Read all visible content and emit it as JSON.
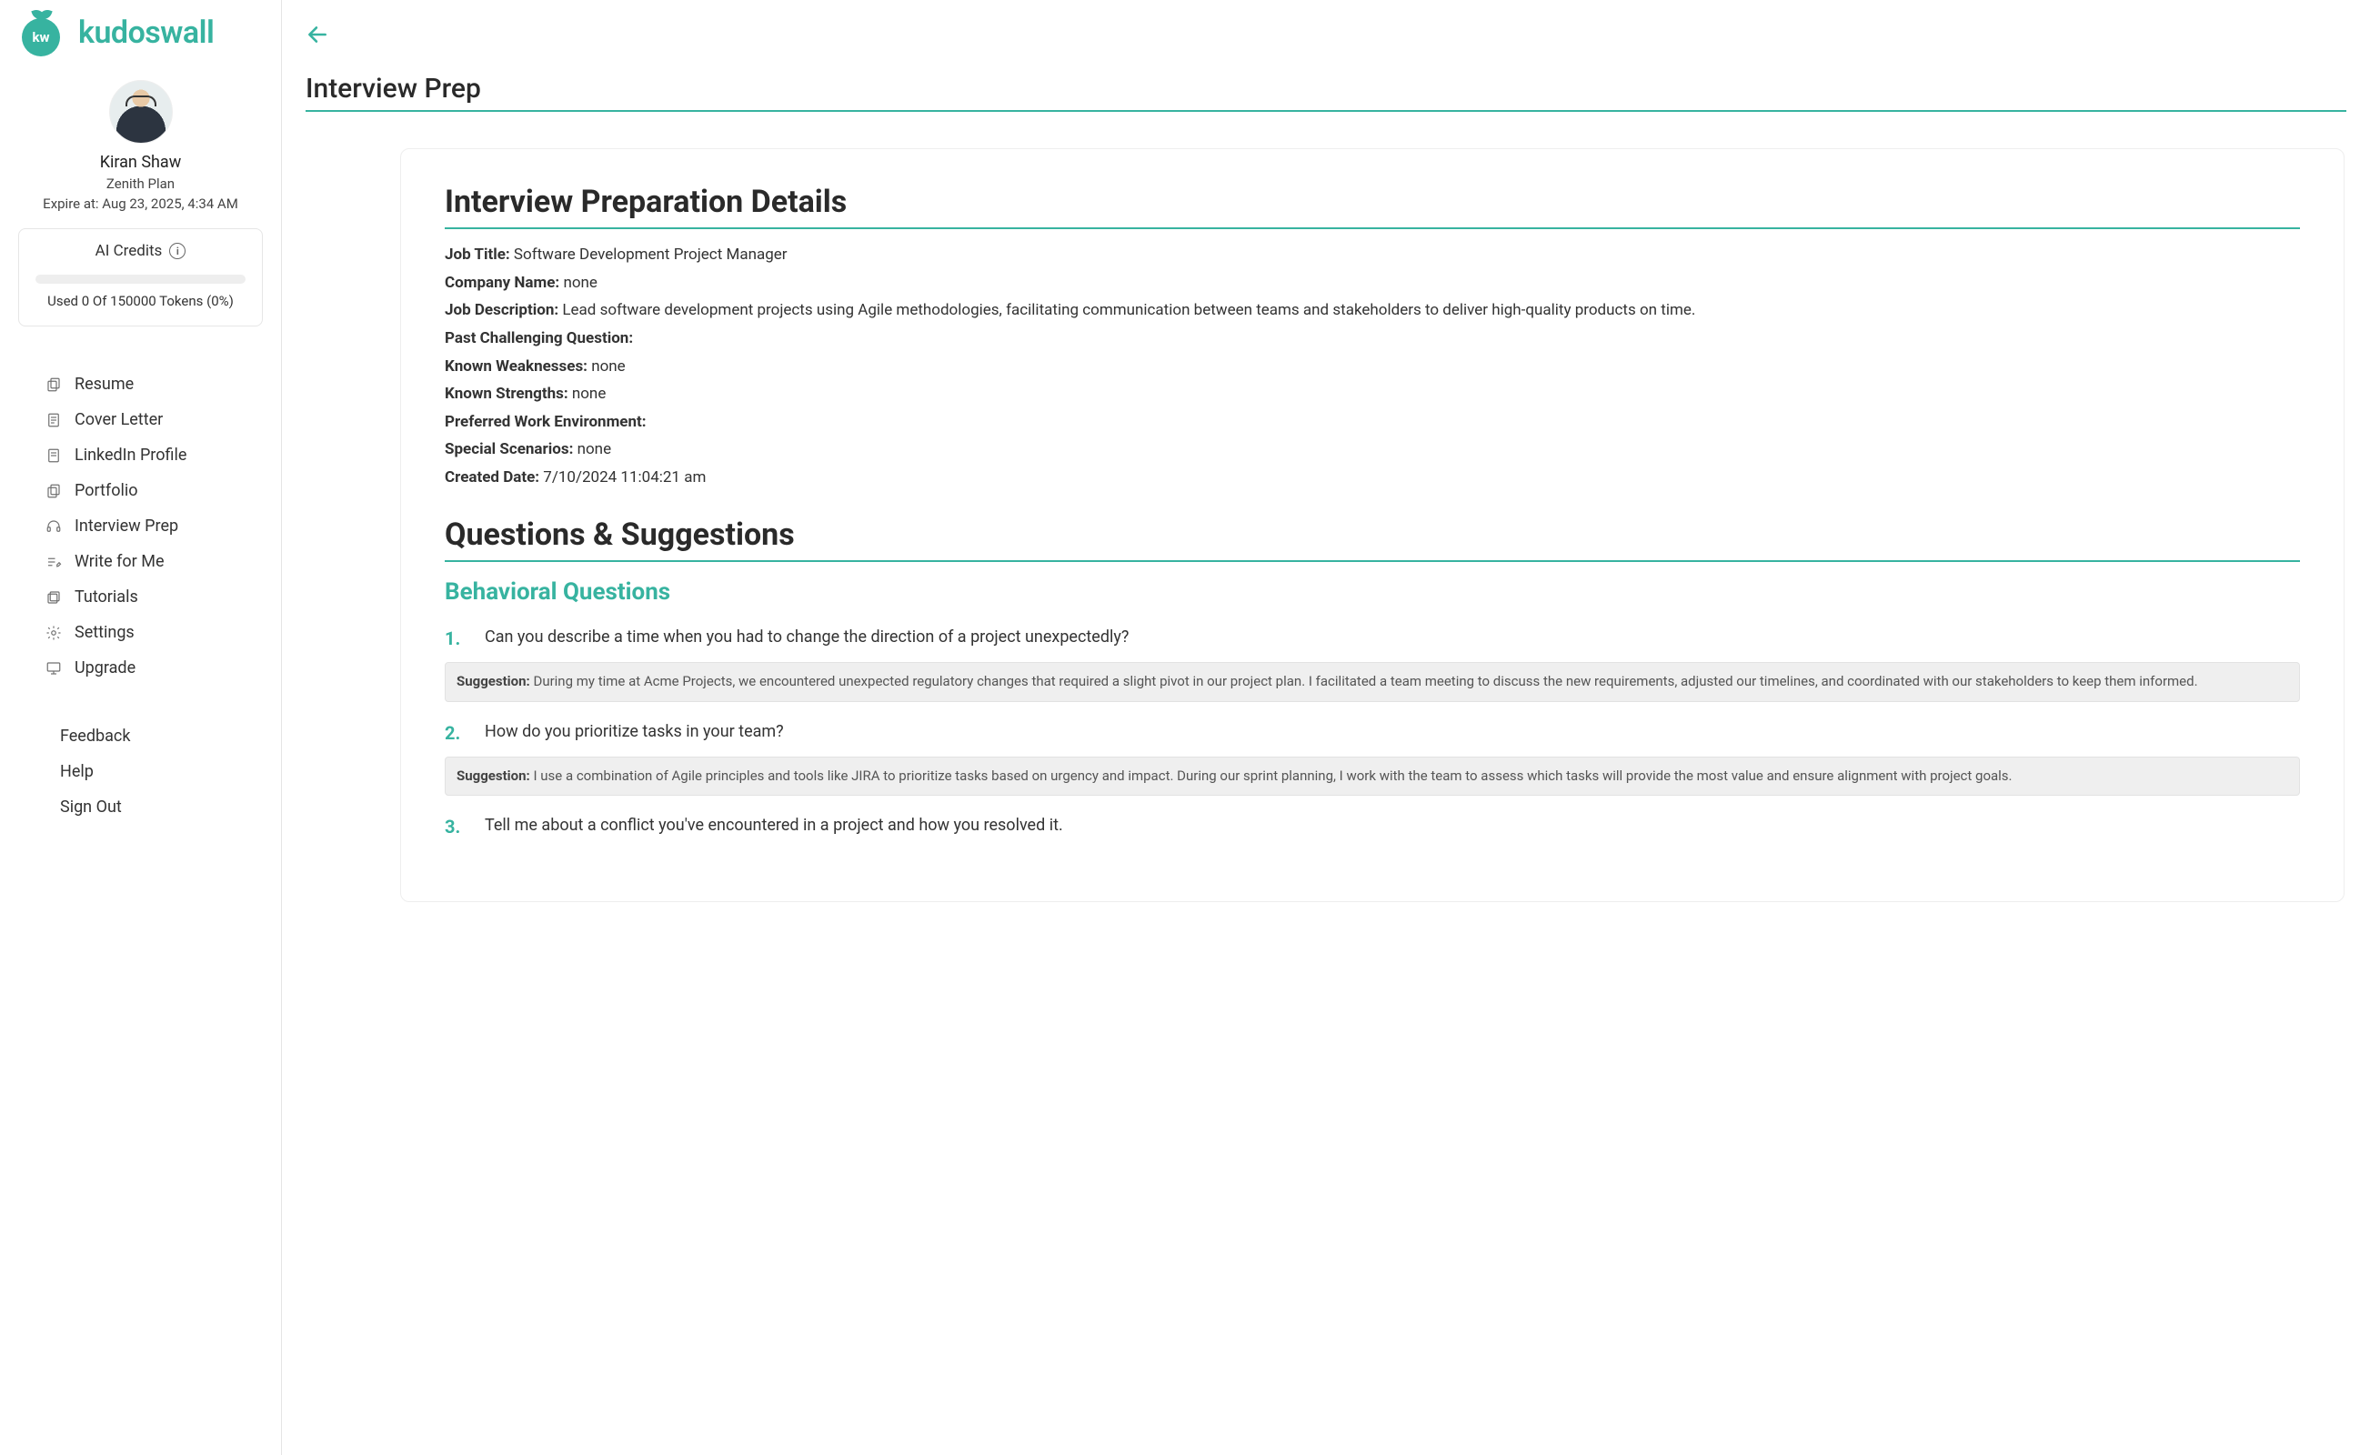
{
  "brand": {
    "name": "kudoswall",
    "mark": "kw"
  },
  "user": {
    "name": "Kiran Shaw",
    "plan": "Zenith Plan",
    "expire_at": "Expire at: Aug 23, 2025, 4:34 AM"
  },
  "credits": {
    "title": "AI Credits",
    "usage_text": "Used 0 Of 150000 Tokens (0%)"
  },
  "nav": {
    "items": [
      {
        "label": "Resume",
        "icon": "copy-icon"
      },
      {
        "label": "Cover Letter",
        "icon": "document-icon"
      },
      {
        "label": "LinkedIn Profile",
        "icon": "document-icon"
      },
      {
        "label": "Portfolio",
        "icon": "copy-icon"
      },
      {
        "label": "Interview Prep",
        "icon": "headset-icon"
      },
      {
        "label": "Write for Me",
        "icon": "write-icon"
      },
      {
        "label": "Tutorials",
        "icon": "layers-icon"
      },
      {
        "label": "Settings",
        "icon": "gear-icon"
      },
      {
        "label": "Upgrade",
        "icon": "monitor-icon"
      }
    ]
  },
  "footer": {
    "feedback": "Feedback",
    "help": "Help",
    "signout": "Sign Out"
  },
  "page": {
    "title": "Interview Prep"
  },
  "details": {
    "heading": "Interview Preparation Details",
    "labels": {
      "job_title": "Job Title:",
      "company_name": "Company Name:",
      "job_description": "Job Description:",
      "past_challenging_question": "Past Challenging Question:",
      "known_weaknesses": "Known Weaknesses:",
      "known_strengths": "Known Strengths:",
      "preferred_env": "Preferred Work Environment:",
      "special_scenarios": "Special Scenarios:",
      "created_date": "Created Date:"
    },
    "values": {
      "job_title": "Software Development Project Manager",
      "company_name": "none",
      "job_description": "Lead software development projects using Agile methodologies, facilitating communication between teams and stakeholders to deliver high-quality products on time.",
      "past_challenging_question": "",
      "known_weaknesses": "none",
      "known_strengths": "none",
      "preferred_env": "",
      "special_scenarios": "none",
      "created_date": "7/10/2024 11:04:21 am"
    }
  },
  "qs": {
    "heading": "Questions & Suggestions",
    "behavioral_heading": "Behavioral Questions",
    "suggestion_label": "Suggestion:",
    "items": [
      {
        "num": "1.",
        "question": "Can you describe a time when you had to change the direction of a project unexpectedly?",
        "suggestion": "During my time at Acme Projects, we encountered unexpected regulatory changes that required a slight pivot in our project plan. I facilitated a team meeting to discuss the new requirements, adjusted our timelines, and coordinated with our stakeholders to keep them informed."
      },
      {
        "num": "2.",
        "question": "How do you prioritize tasks in your team?",
        "suggestion": "I use a combination of Agile principles and tools like JIRA to prioritize tasks based on urgency and impact. During our sprint planning, I work with the team to assess which tasks will provide the most value and ensure alignment with project goals."
      },
      {
        "num": "3.",
        "question": "Tell me about a conflict you've encountered in a project and how you resolved it.",
        "suggestion": ""
      }
    ]
  }
}
